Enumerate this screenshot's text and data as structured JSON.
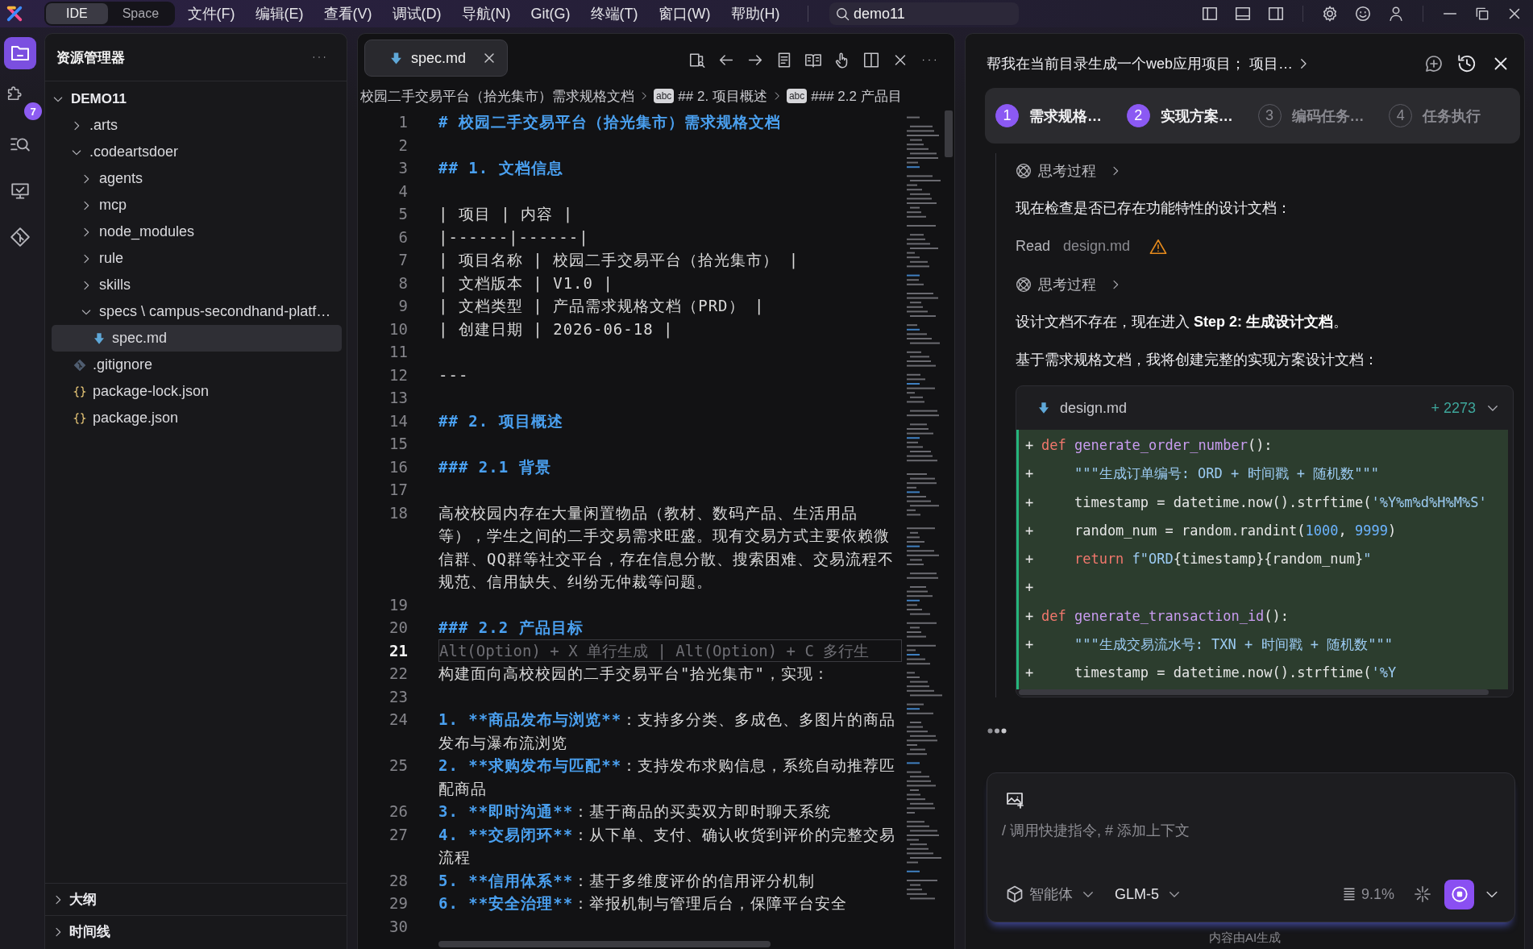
{
  "title_bar": {
    "modes": [
      {
        "label": "IDE",
        "selected": true
      },
      {
        "label": "Space",
        "selected": false
      }
    ],
    "menu": [
      "文件(F)",
      "编辑(E)",
      "查看(V)",
      "调试(D)",
      "导航(N)",
      "Git(G)",
      "终端(T)",
      "窗口(W)",
      "帮助(H)"
    ],
    "search": {
      "value": "demo11"
    }
  },
  "activity_bar": {
    "items": [
      {
        "kind": "explorer",
        "selected": true
      },
      {
        "kind": "extensions",
        "selected": false,
        "badge": "7"
      },
      {
        "kind": "search",
        "selected": false
      },
      {
        "kind": "remote",
        "selected": false
      },
      {
        "kind": "git",
        "selected": false
      }
    ]
  },
  "explorer": {
    "title": "资源管理器",
    "tree": [
      {
        "label": "DEMO11",
        "kind": "folder",
        "expanded": true,
        "selected": false,
        "children": [
          {
            "label": ".arts",
            "kind": "folder",
            "expanded": false,
            "selected": false
          },
          {
            "label": ".codeartsdoer",
            "kind": "folder",
            "expanded": true,
            "selected": false,
            "children": [
              {
                "label": "agents",
                "kind": "folder",
                "expanded": false,
                "selected": false
              },
              {
                "label": "mcp",
                "kind": "folder",
                "expanded": false,
                "selected": false
              },
              {
                "label": "node_modules",
                "kind": "folder",
                "expanded": false,
                "selected": false
              },
              {
                "label": "rule",
                "kind": "folder",
                "expanded": false,
                "selected": false
              },
              {
                "label": "skills",
                "kind": "folder",
                "expanded": false,
                "selected": false
              },
              {
                "label": "specs \\ campus-secondhand-platf…",
                "kind": "folder",
                "expanded": true,
                "selected": false,
                "children": [
                  {
                    "label": "spec.md",
                    "kind": "markdown",
                    "selected": true
                  }
                ]
              }
            ]
          },
          {
            "label": ".gitignore",
            "kind": "git",
            "selected": false
          },
          {
            "label": "package-lock.json",
            "kind": "json",
            "selected": false
          },
          {
            "label": "package.json",
            "kind": "json",
            "selected": false
          }
        ]
      }
    ],
    "sections": [
      {
        "label": "大纲",
        "expanded": false
      },
      {
        "label": "时间线",
        "expanded": false
      }
    ]
  },
  "editor": {
    "tabs": [
      {
        "label": "spec.md",
        "selected": true
      }
    ],
    "breadcrumbs": [
      {
        "text": "校园二手交易平台（拾光集市）需求规格文档"
      },
      {
        "symbol": "abc",
        "text": "## 2. 项目概述"
      },
      {
        "symbol": "abc",
        "text": "### 2.2 产品目"
      }
    ],
    "lines": [
      {
        "number": "1",
        "kind": "heading",
        "text": "# 校园二手交易平台（拾光集市）需求规格文档",
        "current": false
      },
      {
        "number": "2",
        "kind": "blank",
        "current": false
      },
      {
        "number": "3",
        "kind": "heading",
        "text": "## 1. 文档信息",
        "current": false
      },
      {
        "number": "4",
        "kind": "blank",
        "current": false
      },
      {
        "number": "5",
        "kind": "text",
        "text": "| 项目 | 内容 |",
        "current": false
      },
      {
        "number": "6",
        "kind": "text",
        "text": "|------|------|",
        "current": false
      },
      {
        "number": "7",
        "kind": "text",
        "text": "| 项目名称 | 校园二手交易平台（拾光集市） |",
        "current": false
      },
      {
        "number": "8",
        "kind": "text",
        "text": "| 文档版本 | V1.0 |",
        "current": false
      },
      {
        "number": "9",
        "kind": "text",
        "text": "| 文档类型 | 产品需求规格文档（PRD） |",
        "current": false
      },
      {
        "number": "10",
        "kind": "text",
        "text": "| 创建日期 | 2026-06-18 |",
        "current": false
      },
      {
        "number": "11",
        "kind": "blank",
        "current": false
      },
      {
        "number": "12",
        "kind": "text",
        "text": "---",
        "current": false
      },
      {
        "number": "13",
        "kind": "blank",
        "current": false
      },
      {
        "number": "14",
        "kind": "heading",
        "text": "## 2. 项目概述",
        "current": false
      },
      {
        "number": "15",
        "kind": "blank",
        "current": false
      },
      {
        "number": "16",
        "kind": "heading",
        "text": "### 2.1 背景",
        "current": false
      },
      {
        "number": "17",
        "kind": "blank",
        "current": false
      },
      {
        "number": "18",
        "kind": "text",
        "text": "高校校园内存在大量闲置物品（教材、数码产品、生活用品等），学生之间的二手交易需求旺盛。现有交易方式主要依赖微信群、QQ群等社交平台，存在信息分散、搜索困难、交易流程不规范、信用缺失、纠纷无仲裁等问题。",
        "current": false
      },
      {
        "number": "19",
        "kind": "blank",
        "current": false
      },
      {
        "number": "20",
        "kind": "heading",
        "text": "### 2.2 产品目标",
        "current": false
      },
      {
        "number": "21",
        "kind": "ghost",
        "text": "Alt(Option) + X 单行生成 | Alt(Option) + C 多行生",
        "current": true
      },
      {
        "number": "22",
        "kind": "text",
        "text": "构建面向高校校园的二手交易平台\"拾光集市\"，实现：",
        "current": false
      },
      {
        "number": "23",
        "kind": "blank",
        "current": false
      },
      {
        "number": "24",
        "kind": "list",
        "lead": "1. **商品发布与浏览**",
        "text": "：支持多分类、多成色、多图片的商品发布与瀑布流浏览",
        "current": false
      },
      {
        "number": "25",
        "kind": "list",
        "lead": "2. **求购发布与匹配**",
        "text": "：支持发布求购信息，系统自动推荐匹配商品",
        "current": false
      },
      {
        "number": "26",
        "kind": "list",
        "lead": "3. **即时沟通**",
        "text": "：基于商品的买卖双方即时聊天系统",
        "current": false
      },
      {
        "number": "27",
        "kind": "list",
        "lead": "4. **交易闭环**",
        "text": "：从下单、支付、确认收货到评价的完整交易流程",
        "current": false
      },
      {
        "number": "28",
        "kind": "list",
        "lead": "5. **信用体系**",
        "text": "：基于多维度评价的信用评分机制",
        "current": false
      },
      {
        "number": "29",
        "kind": "list",
        "lead": "6. **安全治理**",
        "text": "：举报机制与管理后台，保障平台安全",
        "current": false
      },
      {
        "number": "30",
        "kind": "blank",
        "current": false
      }
    ]
  },
  "chat": {
    "title": "帮我在当前目录生成一个web应用项目； 项目…",
    "steps": [
      {
        "number": "1",
        "label": "需求规格…",
        "done": true
      },
      {
        "number": "2",
        "label": "实现方案…",
        "done": true
      },
      {
        "number": "3",
        "label": "编码任务…",
        "done": false
      },
      {
        "number": "4",
        "label": "任务执行",
        "done": false
      }
    ],
    "messages": [
      {
        "kind": "thinking",
        "label": "思考过程",
        "expanded": false
      },
      {
        "kind": "text",
        "text": "现在检查是否已存在功能特性的设计文档："
      },
      {
        "kind": "tool",
        "action": "Read",
        "file": "design.md",
        "warning": true
      },
      {
        "kind": "thinking",
        "label": "思考过程",
        "expanded": false
      },
      {
        "kind": "text",
        "text": "设计文档不存在，现在进入 **Step 2: 生成设计文档**。"
      },
      {
        "kind": "text",
        "text": "基于需求规格文档，我将创建完整的实现方案设计文档："
      },
      {
        "kind": "file",
        "file": "design.md",
        "added": "+ 2273",
        "expanded": true,
        "lines": [
          {
            "sign": "+",
            "tokens": [
              {
                "kind": "keyword",
                "text": "def"
              },
              {
                "kind": "function",
                "text": " generate_order_number"
              },
              {
                "kind": "plain",
                "text": "():"
              }
            ]
          },
          {
            "sign": "+",
            "tokens": [
              {
                "kind": "string",
                "text": "    \"\"\"生成订单编号: ORD + 时间戳 + 随机数\"\"\""
              }
            ]
          },
          {
            "sign": "+",
            "tokens": [
              {
                "kind": "plain",
                "text": "    timestamp = datetime.now().strftime("
              },
              {
                "kind": "string",
                "text": "'%Y%m%d%H%M%S'"
              }
            ]
          },
          {
            "sign": "+",
            "tokens": [
              {
                "kind": "plain",
                "text": "    random_num = random.randint("
              },
              {
                "kind": "number",
                "text": "1000"
              },
              {
                "kind": "plain",
                "text": ", "
              },
              {
                "kind": "number",
                "text": "9999"
              },
              {
                "kind": "plain",
                "text": ")"
              }
            ]
          },
          {
            "sign": "+",
            "tokens": [
              {
                "kind": "keyword",
                "text": "    return"
              },
              {
                "kind": "string",
                "text": " f\"ORD"
              },
              {
                "kind": "plain",
                "text": "{timestamp}{random_num}"
              },
              {
                "kind": "string",
                "text": "\""
              }
            ]
          },
          {
            "sign": "+"
          },
          {
            "sign": "+",
            "tokens": [
              {
                "kind": "keyword",
                "text": "def"
              },
              {
                "kind": "function",
                "text": " generate_transaction_id"
              },
              {
                "kind": "plain",
                "text": "():"
              }
            ]
          },
          {
            "sign": "+",
            "tokens": [
              {
                "kind": "string",
                "text": "    \"\"\"生成交易流水号: TXN + 时间戳 + 随机数\"\"\""
              }
            ]
          },
          {
            "sign": "+",
            "tokens": [
              {
                "kind": "plain",
                "text": "    timestamp = datetime.now().strftime("
              },
              {
                "kind": "string",
                "text": "'%Y"
              }
            ]
          }
        ]
      }
    ],
    "typing": true,
    "input": {
      "placeholder": "/ 调用快捷指令, # 添加上下文",
      "agent": "智能体",
      "model": "GLM-5",
      "context": "9.1%"
    },
    "footer": "内容由AI生成"
  }
}
